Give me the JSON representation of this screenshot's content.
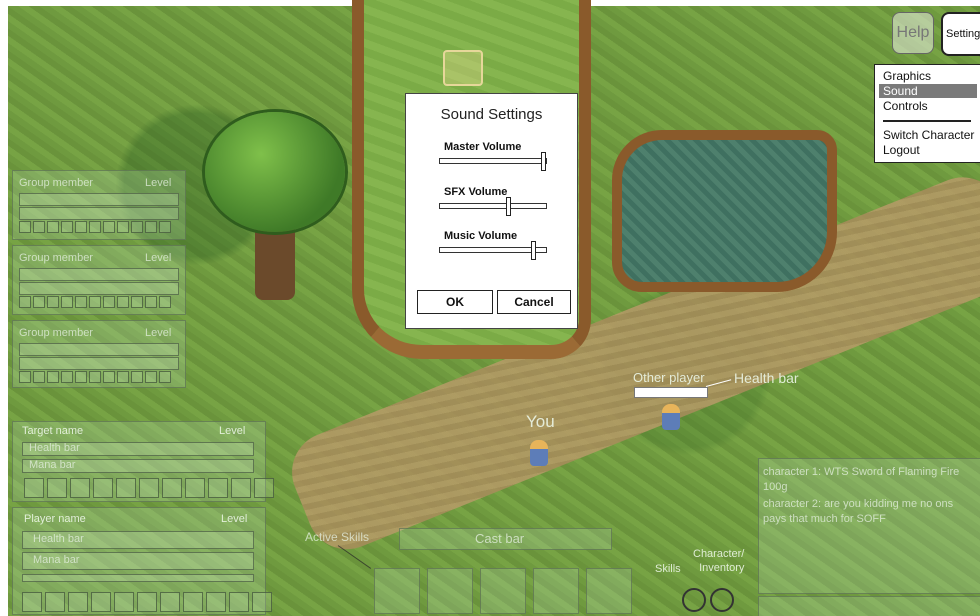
{
  "top_buttons": {
    "help": "Help",
    "settings": "Settings"
  },
  "settings_menu": {
    "items": [
      "Graphics",
      "Sound",
      "Controls",
      "Switch Character",
      "Logout"
    ],
    "selected": "Sound"
  },
  "dialog": {
    "title": "Sound Settings",
    "sliders": [
      {
        "label": "Master Volume",
        "value": 1.0
      },
      {
        "label": "SFX Volume",
        "value": 0.65
      },
      {
        "label": "Music Volume",
        "value": 0.9
      }
    ],
    "ok": "OK",
    "cancel": "Cancel"
  },
  "world_labels": {
    "you": "You",
    "other_player": "Other player",
    "health_bar": "Health bar"
  },
  "target_panel": {
    "name": "Target name",
    "level": "Level",
    "health": "Health bar",
    "mana": "Mana bar"
  },
  "player_panel": {
    "name": "Player name",
    "level": "Level",
    "health": "Health bar",
    "mana": "Mana bar"
  },
  "party_panels": [
    {
      "name": "Group member",
      "level": "Level"
    },
    {
      "name": "Group member",
      "level": "Level"
    },
    {
      "name": "Group member",
      "level": "Level"
    }
  ],
  "hotbar": {
    "active_skills": "Active Skills",
    "cast_bar": "Cast bar",
    "skills": "Skills",
    "character_inventory": "Character/\nInventory"
  },
  "chat": {
    "lines": [
      "character 1: WTS Sword of Flaming Fire 100g",
      "character 2: are you kidding me no ons pays that much for SOFF"
    ]
  }
}
